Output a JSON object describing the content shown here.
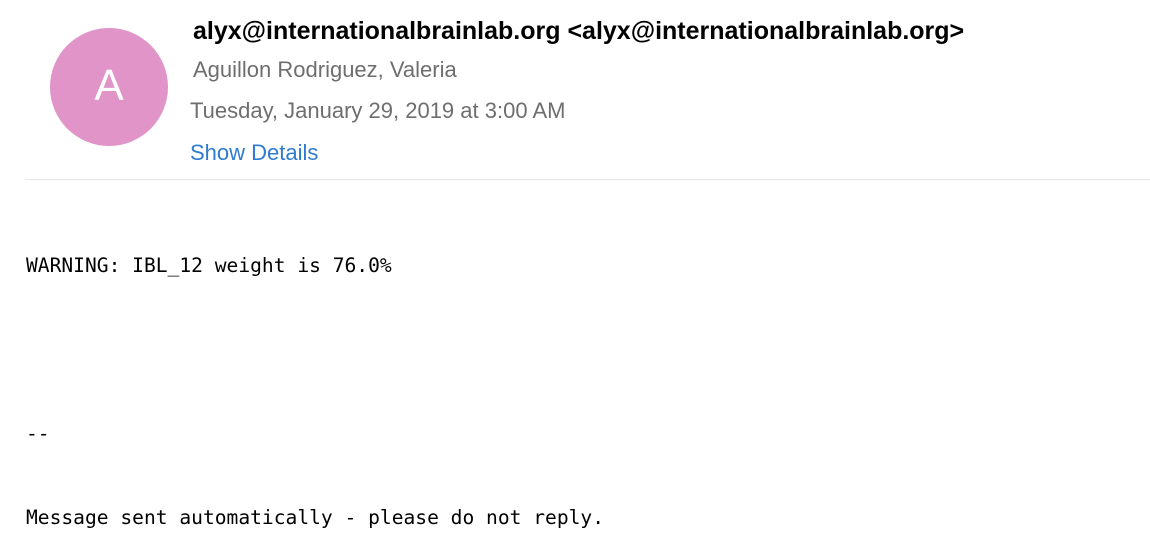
{
  "email": {
    "avatar_initial": "A",
    "avatar_color": "#e094c8",
    "from": "alyx@internationalbrainlab.org <alyx@internationalbrainlab.org>",
    "to": "Aguillon Rodriguez, Valeria",
    "date": "Tuesday, January 29, 2019 at 3:00 AM",
    "show_details_label": "Show Details",
    "link_color": "#2f7bd0",
    "body_lines": [
      "WARNING: IBL_12 weight is 76.0%",
      "",
      "--",
      "Message sent automatically - please do not reply."
    ]
  }
}
